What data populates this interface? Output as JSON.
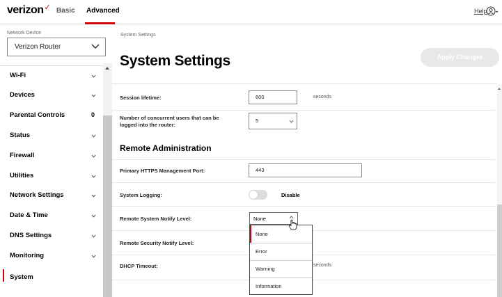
{
  "brand": {
    "name": "verizon",
    "accent": "#cd040b"
  },
  "top_tabs": [
    {
      "label": "Basic"
    },
    {
      "label": "Advanced",
      "active": true
    }
  ],
  "help_label": "Help",
  "sidebar": {
    "network_device_label": "Network Device",
    "network_device_value": "Verizon Router",
    "items": [
      {
        "label": "Wi-Fi",
        "icon": "chevron-down-icon"
      },
      {
        "label": "Devices",
        "icon": "chevron-down-icon"
      },
      {
        "label": "Parental Controls",
        "badge": "0"
      },
      {
        "label": "Status",
        "icon": "chevron-down-icon"
      },
      {
        "label": "Firewall",
        "icon": "chevron-down-icon"
      },
      {
        "label": "Utilities",
        "icon": "chevron-down-icon"
      },
      {
        "label": "Network Settings",
        "icon": "chevron-down-icon"
      },
      {
        "label": "Date & Time",
        "icon": "chevron-down-icon"
      },
      {
        "label": "DNS Settings",
        "icon": "chevron-down-icon"
      },
      {
        "label": "Monitoring",
        "icon": "chevron-down-icon"
      },
      {
        "label": "System",
        "active": true
      }
    ]
  },
  "main": {
    "breadcrumb": "System Settings",
    "title": "System Settings",
    "apply_label": "Apply Changes",
    "session_lifetime": {
      "label": "Session lifetime:",
      "value": "600",
      "unit": "seconds"
    },
    "concurrent_users": {
      "label_line1": "Number of concurrent users that can be",
      "label_line2": "logged into the router:",
      "value": "5"
    },
    "remote_admin_title": "Remote Administration",
    "https_port": {
      "label": "Primary HTTPS Management Port:",
      "value": "443"
    },
    "system_logging": {
      "label": "System Logging:",
      "state": "Disable"
    },
    "remote_system_notify": {
      "label": "Remote System Notify Level:",
      "value": "None"
    },
    "remote_security_notify": {
      "label": "Remote Security Notify Level:"
    },
    "dhcp_timeout": {
      "label": "DHCP Timeout:",
      "unit": "seconds"
    },
    "dropdown_options": [
      "None",
      "Error",
      "Warning",
      "Information"
    ]
  }
}
